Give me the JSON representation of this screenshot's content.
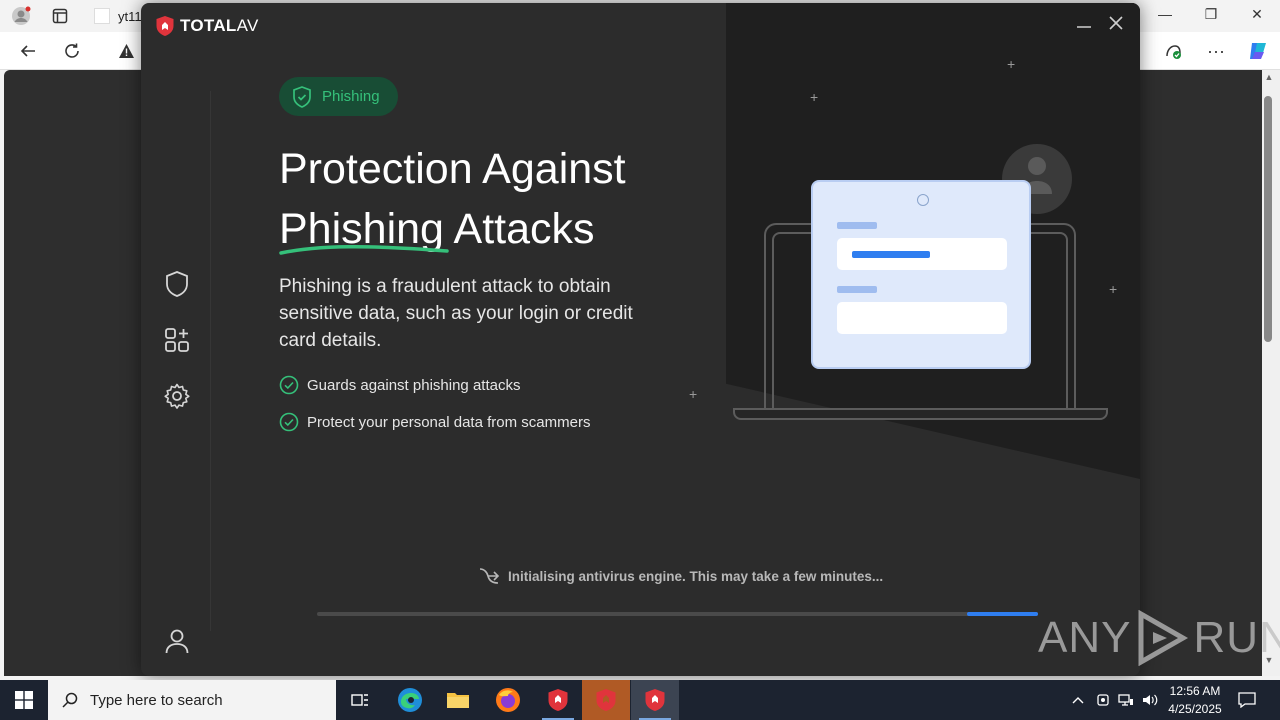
{
  "browser": {
    "tab_title": "yt11",
    "icons": [
      "profile-icon",
      "tabs-icon",
      "back-icon",
      "refresh-icon",
      "warning-icon",
      "extension-icon",
      "more-icon",
      "copilot-icon"
    ]
  },
  "app": {
    "brand_bold": "TOTAL",
    "brand_light": "AV",
    "feature_pill": "Phishing",
    "headline_line1": "Protection Against",
    "headline_underlined": "Phishing",
    "headline_rest": " Attacks",
    "description": "Phishing is a fraudulent attack to obtain sensitive data, such as your login or credit card details.",
    "features": [
      "Guards against phishing attacks",
      "Protect your personal data from scammers"
    ],
    "status_text": "Initialising antivirus engine. This may take a few minutes...",
    "progress": {
      "start": 0.901,
      "end": 1.0
    },
    "sidebar_icons": [
      "shield-icon",
      "apps-add-icon",
      "settings-gear-icon",
      "user-account-icon"
    ],
    "colors": {
      "accent_green": "#35c07a",
      "accent_blue": "#2f7ef0",
      "brand_red": "#e0343c",
      "window_bg": "#2c2c2c"
    }
  },
  "watermark": {
    "text_left": "ANY",
    "text_right": "RUN"
  },
  "taskbar": {
    "search_placeholder": "Type here to search",
    "apps": [
      "task-view-icon",
      "edge-icon",
      "file-explorer-icon",
      "firefox-icon",
      "totalav-icon",
      "totalav-icon",
      "totalav-icon"
    ],
    "time": "12:56 AM",
    "date": "4/25/2025"
  }
}
